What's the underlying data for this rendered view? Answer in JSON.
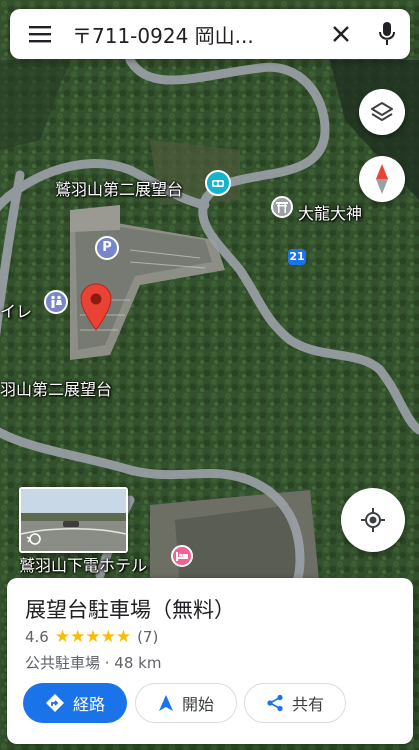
{
  "search": {
    "query": "〒711-0924 岡山..."
  },
  "map_labels": {
    "viewpoint_2_top": "鷲羽山第二展望台",
    "shrine": "大龍大神",
    "route_number": "21",
    "toilet": "イレ",
    "viewpoint_2_left": "羽山第二展望台",
    "hotel": "鷲羽山下電ホテル"
  },
  "place": {
    "title": "展望台駐車場（無料）",
    "rating": "4.6",
    "stars": "★★★★★",
    "review_count": "(7)",
    "category_distance": "公共駐車場 · 48 km"
  },
  "actions": {
    "directions": "経路",
    "start": "開始",
    "share": "共有"
  },
  "icons": {
    "menu": "menu-icon",
    "clear": "close-icon",
    "mic": "microphone-icon",
    "layers": "layers-icon",
    "compass": "compass-icon",
    "location": "my-location-icon"
  },
  "colors": {
    "primary": "#1a73e8",
    "pin": "#ea4335",
    "star": "#fbbc04",
    "teal": "#12b5cb",
    "road": "#9aa0a6"
  }
}
